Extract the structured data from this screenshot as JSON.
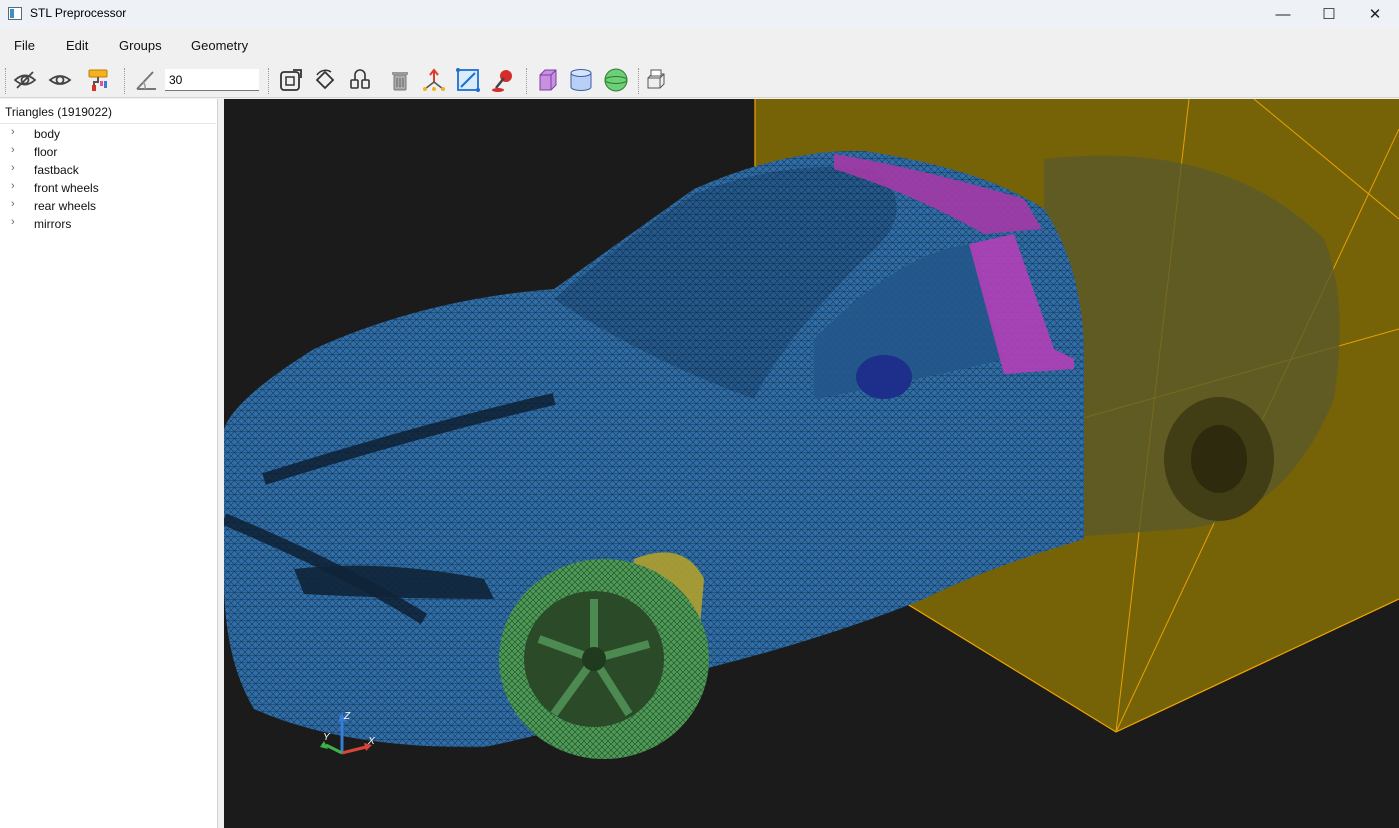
{
  "window": {
    "title": "STL Preprocessor",
    "minimize": "—",
    "maximize": "☐",
    "close": "✕"
  },
  "menu": {
    "file": "File",
    "edit": "Edit",
    "groups": "Groups",
    "geometry": "Geometry"
  },
  "toolbar": {
    "angle_value": "30",
    "icons": [
      "hide-icon",
      "show-icon",
      "paint-roller-icon",
      "feature-angle-icon",
      "fit-view-icon",
      "rotate-view-icon",
      "reset-view-icon",
      "delete-icon",
      "normals-icon",
      "bounding-box-icon",
      "color-picker-icon",
      "box-primitive-icon",
      "cylinder-primitive-icon",
      "sphere-primitive-icon",
      "export-icon"
    ]
  },
  "tree": {
    "header": "Triangles (1919022)",
    "items": [
      "body",
      "floor",
      "fastback",
      "front wheels",
      "rear wheels",
      "mirrors"
    ]
  },
  "viewport": {
    "axes": {
      "x": "X",
      "y": "Y",
      "z": "Z"
    },
    "colors": {
      "background": "#1b1b1b",
      "body": "#3a7fc4",
      "box": "#c9a200",
      "fastback": "#c23bbf",
      "wheels": "#4fa05a"
    }
  }
}
